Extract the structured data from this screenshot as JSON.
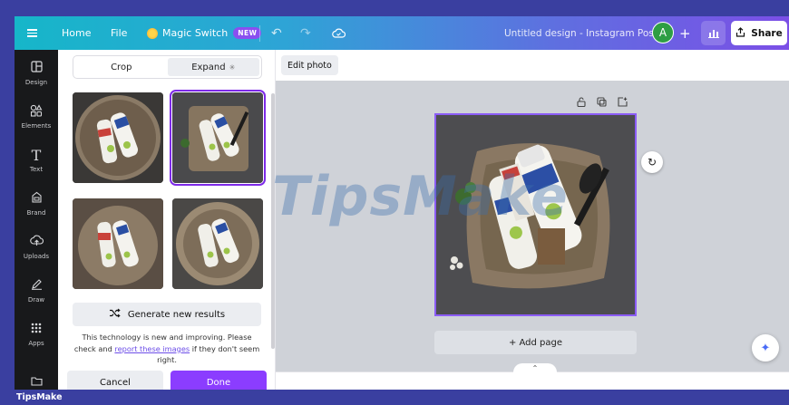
{
  "topbar": {
    "home": "Home",
    "file": "File",
    "magic_switch": "Magic Switch",
    "new_badge": "NEW",
    "document_title": "Untitled design - Instagram Post",
    "avatar_initial": "A",
    "share": "Share"
  },
  "rail": {
    "items": [
      {
        "label": "Design",
        "icon": "layout-icon"
      },
      {
        "label": "Elements",
        "icon": "shapes-icon"
      },
      {
        "label": "Text",
        "icon": "text-icon"
      },
      {
        "label": "Brand",
        "icon": "brand-icon"
      },
      {
        "label": "Uploads",
        "icon": "cloud-upload-icon"
      },
      {
        "label": "Draw",
        "icon": "pen-icon"
      },
      {
        "label": "Apps",
        "icon": "apps-grid-icon"
      }
    ]
  },
  "panel": {
    "tabs": [
      "Crop",
      "Expand"
    ],
    "active_tab": "Expand",
    "generate_button": "Generate new results",
    "disclaimer_part1": "This technology is new and improving. Please check and",
    "disclaimer_link": "report these images",
    "disclaimer_part2": "if they don't seem right.",
    "cancel": "Cancel",
    "done": "Done"
  },
  "canvas": {
    "edit_photo": "Edit photo",
    "add_page": "+ Add page"
  },
  "watermark": "TipsMake",
  "footer": "TipsMake",
  "colors": {
    "accent": "#8b3dff",
    "rail_bg": "#18191b"
  }
}
